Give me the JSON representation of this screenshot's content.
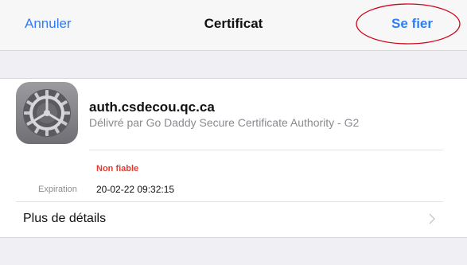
{
  "navbar": {
    "cancel_label": "Annuler",
    "title": "Certificat",
    "trust_label": "Se fier"
  },
  "certificate": {
    "icon": "gear-icon",
    "name": "auth.csdecou.qc.ca",
    "issuer": "Délivré par Go Daddy Secure Certificate Authority - G2",
    "status": "Non fiable",
    "expiration_label": "Expiration",
    "expiration_value": "20-02-22 09:32:15"
  },
  "details": {
    "label": "Plus de détails",
    "icon": "chevron-right-icon"
  },
  "colors": {
    "accent": "#2f7df6",
    "untrusted": "#e53b30",
    "highlight": "#d0021b"
  }
}
